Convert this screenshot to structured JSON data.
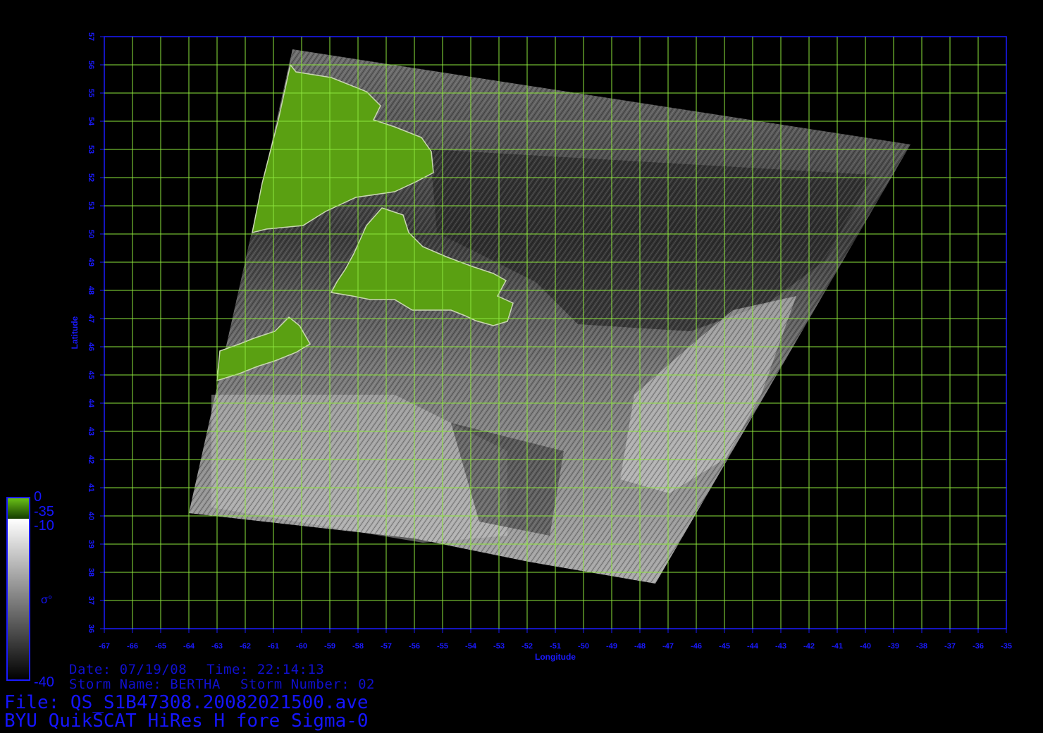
{
  "header": {
    "date_label": "Date:",
    "date": "07/19/08",
    "time_label": "Time:",
    "time": "22:14:13",
    "storm_name_label": "Storm Name:",
    "storm_name": "BERTHA",
    "storm_number_label": "Storm Number:",
    "storm_number": "02"
  },
  "footer": {
    "file_line": "File: QS_S1B47308.20082021500.ave",
    "product_line": "BYU QuikSCAT HiRes H fore Sigma-0"
  },
  "axes": {
    "x_label": "Longitude",
    "y_label": "Latitude",
    "lon_range": [
      -67,
      -35
    ],
    "lat_range": [
      36,
      57
    ],
    "grid_step_deg": 1
  },
  "colorbar": {
    "land_top": "0",
    "land_bottom": "-35",
    "ocean_top": "-10",
    "ocean_bottom": "-40",
    "symbol": "σ°"
  },
  "colors": {
    "background": "#000000",
    "grid": "#8ce63c",
    "axis": "#1a1aff",
    "land": "#5aa012"
  }
}
